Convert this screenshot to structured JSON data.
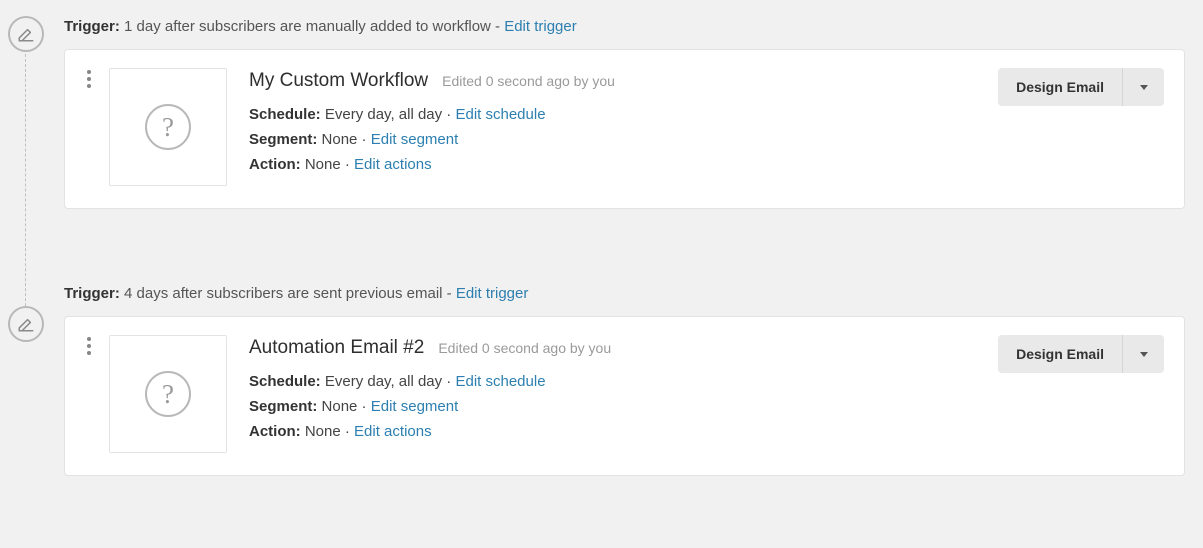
{
  "steps": [
    {
      "trigger": {
        "label": "Trigger:",
        "text": "1 day after subscribers are manually added to workflow - ",
        "edit": "Edit trigger"
      },
      "card": {
        "title": "My Custom Workflow",
        "edited_prefix": "Edited",
        "edited_value": "0 second ago by you",
        "schedule": {
          "label": "Schedule:",
          "value": "Every day, all day",
          "edit": "Edit schedule"
        },
        "segment": {
          "label": "Segment:",
          "value": "None",
          "edit": "Edit segment"
        },
        "action": {
          "label": "Action:",
          "value": "None",
          "edit": "Edit actions"
        },
        "design_label": "Design Email",
        "thumb_glyph": "?"
      }
    },
    {
      "trigger": {
        "label": "Trigger:",
        "text": "4 days after subscribers are sent previous email - ",
        "edit": "Edit trigger"
      },
      "card": {
        "title": "Automation Email #2",
        "edited_prefix": "Edited",
        "edited_value": "0 second ago by you",
        "schedule": {
          "label": "Schedule:",
          "value": "Every day, all day",
          "edit": "Edit schedule"
        },
        "segment": {
          "label": "Segment:",
          "value": "None",
          "edit": "Edit segment"
        },
        "action": {
          "label": "Action:",
          "value": "None",
          "edit": "Edit actions"
        },
        "design_label": "Design Email",
        "thumb_glyph": "?"
      }
    }
  ]
}
